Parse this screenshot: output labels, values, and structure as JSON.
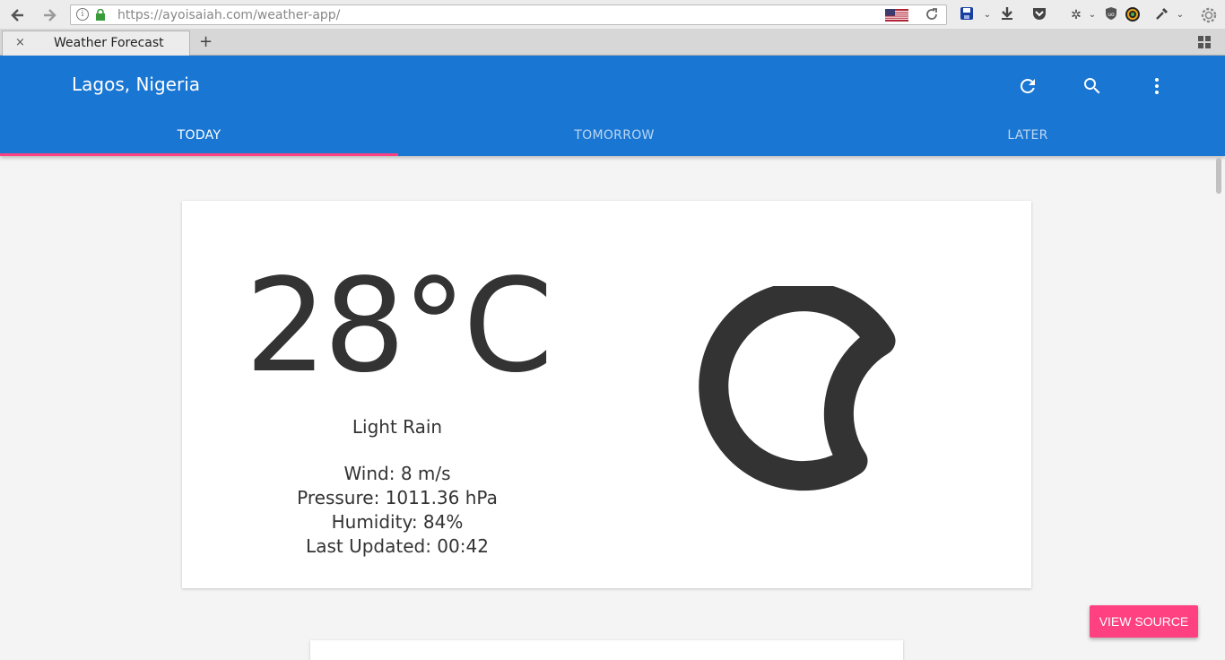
{
  "browser": {
    "url_host": "https://ayoisaiah.com",
    "url_path": "/weather-app/",
    "tab_title": "Weather Forecast",
    "tab_close": "×",
    "new_tab": "+"
  },
  "app": {
    "title": "Lagos, Nigeria",
    "accent": "#1976d2",
    "indicator_color": "#ff4081",
    "tabs": [
      {
        "label": "TODAY",
        "active": true
      },
      {
        "label": "TOMORROW",
        "active": false
      },
      {
        "label": "LATER",
        "active": false
      }
    ],
    "header_icons": [
      "refresh-icon",
      "search-icon",
      "more-vert-icon"
    ]
  },
  "weather": {
    "temperature": "28°C",
    "description": "Light Rain",
    "wind": "Wind: 8 m/s",
    "pressure": "Pressure: 1011.36 hPa",
    "humidity": "Humidity: 84%",
    "last_updated": "Last Updated: 00:42",
    "icon": "moon-icon"
  },
  "fab": {
    "label": "VIEW SOURCE"
  }
}
